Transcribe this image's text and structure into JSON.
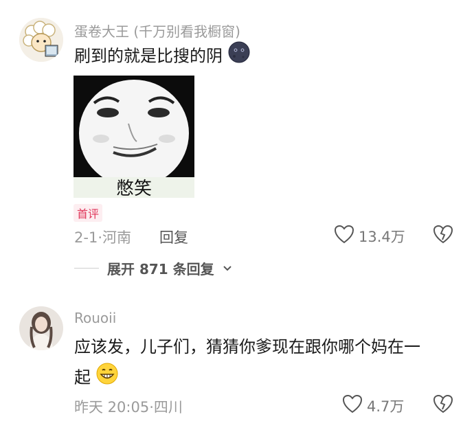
{
  "comments": [
    {
      "username": "蛋卷大王 (千万别看我橱窗)",
      "text": "刷到的就是比搜的阴",
      "emoji": "dark-moon-emoji",
      "image_caption": "憋笑",
      "badge": "首评",
      "date": "2-1",
      "location": "河南",
      "reply_label": "回复",
      "likes": "13.4万"
    },
    {
      "username": "Rouoii",
      "text_line1": "应该发，儿子们，猜猜你爹现在跟你哪个妈在一",
      "text_line2": "起",
      "emoji": "grin-emoji",
      "date": "昨天 20:05",
      "location": "四川",
      "likes": "4.7万"
    }
  ],
  "expand": {
    "label": "展开 871 条回复"
  },
  "colors": {
    "meta_gray": "#9a9a9a",
    "badge_red": "#e0385b"
  }
}
